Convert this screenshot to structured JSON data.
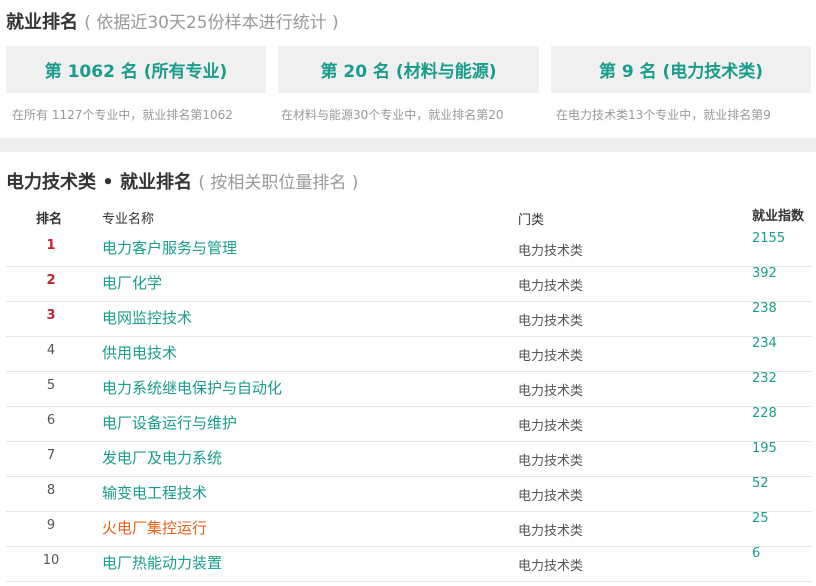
{
  "summary": {
    "title": "就业排名",
    "subtitle": "( 依据近30天25份样本进行统计 )",
    "cards": [
      {
        "label": "第 1062 名 (所有专业)",
        "note": "在所有 1127个专业中，就业排名第1062"
      },
      {
        "label": "第 20 名 (材料与能源)",
        "note": "在材料与能源30个专业中，就业排名第20"
      },
      {
        "label": "第 9 名 (电力技术类)",
        "note": "在电力技术类13个专业中，就业排名第9"
      }
    ]
  },
  "ranking": {
    "title": "电力技术类 • 就业排名",
    "subtitle": "( 按相关职位量排名 )",
    "headers": {
      "rank": "排名",
      "name": "专业名称",
      "category": "门类",
      "index": "就业指数"
    },
    "rows": [
      {
        "rank": "1",
        "name": "电力客户服务与管理",
        "category": "电力技术类",
        "index": "2155"
      },
      {
        "rank": "2",
        "name": "电厂化学",
        "category": "电力技术类",
        "index": "392"
      },
      {
        "rank": "3",
        "name": "电网监控技术",
        "category": "电力技术类",
        "index": "238"
      },
      {
        "rank": "4",
        "name": "供用电技术",
        "category": "电力技术类",
        "index": "234"
      },
      {
        "rank": "5",
        "name": "电力系统继电保护与自动化",
        "category": "电力技术类",
        "index": "232"
      },
      {
        "rank": "6",
        "name": "电厂设备运行与维护",
        "category": "电力技术类",
        "index": "228"
      },
      {
        "rank": "7",
        "name": "发电厂及电力系统",
        "category": "电力技术类",
        "index": "195"
      },
      {
        "rank": "8",
        "name": "输变电工程技术",
        "category": "电力技术类",
        "index": "52"
      },
      {
        "rank": "9",
        "name": "火电厂集控运行",
        "category": "电力技术类",
        "index": "25"
      },
      {
        "rank": "10",
        "name": "电厂热能动力装置",
        "category": "电力技术类",
        "index": "6"
      }
    ]
  },
  "colors": {
    "accent": "#1a9c8c",
    "top_rank": "#c0262d",
    "highlight": "#e8621a",
    "card_bg": "#f0f0f0"
  }
}
